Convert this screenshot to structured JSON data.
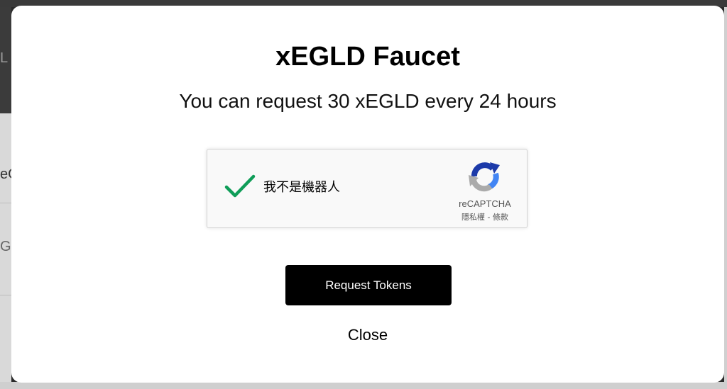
{
  "background": {
    "peek_texts": [
      "L",
      "eG",
      "G"
    ]
  },
  "modal": {
    "title": "xEGLD Faucet",
    "subtitle": "You can request 30 xEGLD every 24 hours",
    "captcha": {
      "checked": true,
      "label": "我不是機器人",
      "brand": "reCAPTCHA",
      "privacy_link": "隱私權",
      "separator": " - ",
      "terms_link": "條款",
      "check_color": "#0f9d58",
      "icon": "checkmark-icon",
      "logo_icon": "recaptcha-logo-icon"
    },
    "request_button_label": "Request Tokens",
    "close_button_label": "Close"
  },
  "colors": {
    "button_bg": "#000000",
    "button_text": "#ffffff",
    "modal_bg": "#ffffff",
    "backdrop": "#2a2a2a"
  }
}
